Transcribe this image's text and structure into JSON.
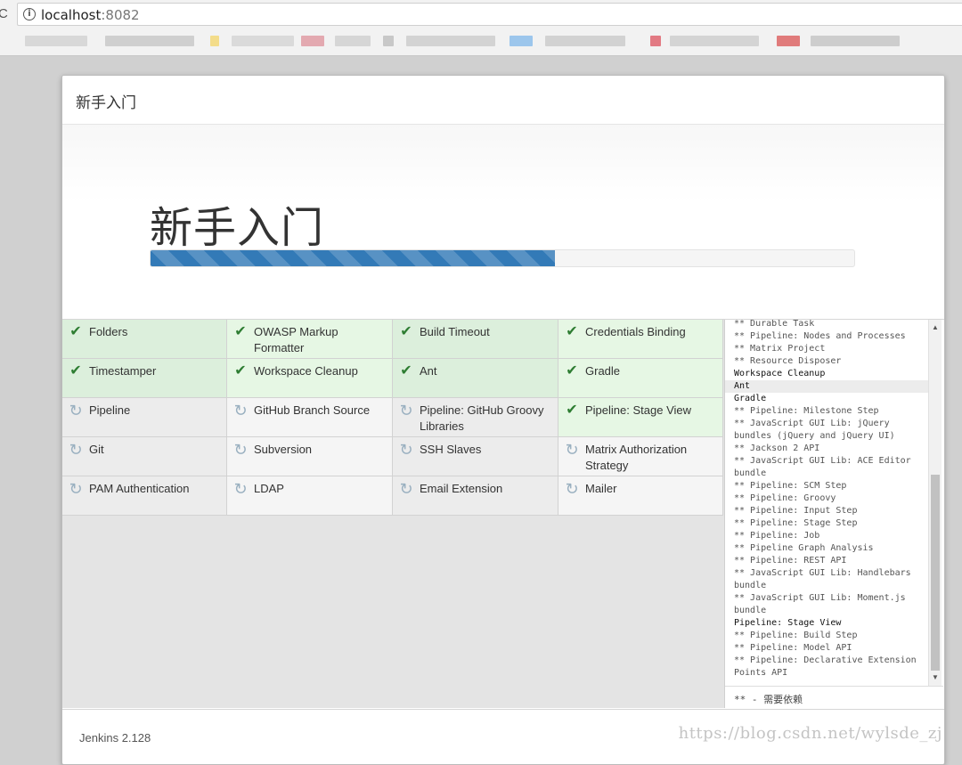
{
  "browser": {
    "url_host": "localhost",
    "url_port": ":8082"
  },
  "dialog": {
    "header_title": "新手入门",
    "hero_title": "新手入门",
    "progress_fraction": 0.575
  },
  "plugins": [
    {
      "name": "Folders",
      "status": "done"
    },
    {
      "name": "OWASP Markup Formatter",
      "status": "done"
    },
    {
      "name": "Build Timeout",
      "status": "done"
    },
    {
      "name": "Credentials Binding",
      "status": "done"
    },
    {
      "name": "Timestamper",
      "status": "done"
    },
    {
      "name": "Workspace Cleanup",
      "status": "done"
    },
    {
      "name": "Ant",
      "status": "done"
    },
    {
      "name": "Gradle",
      "status": "done"
    },
    {
      "name": "Pipeline",
      "status": "pending"
    },
    {
      "name": "GitHub Branch Source",
      "status": "pending"
    },
    {
      "name": "Pipeline: GitHub Groovy Libraries",
      "status": "pending"
    },
    {
      "name": "Pipeline: Stage View",
      "status": "done"
    },
    {
      "name": "Git",
      "status": "pending"
    },
    {
      "name": "Subversion",
      "status": "pending"
    },
    {
      "name": "SSH Slaves",
      "status": "pending"
    },
    {
      "name": "Matrix Authorization Strategy",
      "status": "pending"
    },
    {
      "name": "PAM Authentication",
      "status": "pending"
    },
    {
      "name": "LDAP",
      "status": "pending"
    },
    {
      "name": "Email Extension",
      "status": "pending"
    },
    {
      "name": "Mailer",
      "status": "pending"
    }
  ],
  "log": {
    "lines": [
      {
        "text": "** Durable Task",
        "kind": "dep"
      },
      {
        "text": "** Pipeline: Nodes and Processes",
        "kind": "dep"
      },
      {
        "text": "** Matrix Project",
        "kind": "dep"
      },
      {
        "text": "** Resource Disposer",
        "kind": "dep"
      },
      {
        "text": "Workspace Cleanup",
        "kind": "head"
      },
      {
        "text": "Ant",
        "kind": "head-hl"
      },
      {
        "text": "Gradle",
        "kind": "head"
      },
      {
        "text": "** Pipeline: Milestone Step",
        "kind": "dep"
      },
      {
        "text": "** JavaScript GUI Lib: jQuery bundles (jQuery and jQuery UI)",
        "kind": "dep"
      },
      {
        "text": "** Jackson 2 API",
        "kind": "dep"
      },
      {
        "text": "** JavaScript GUI Lib: ACE Editor bundle",
        "kind": "dep"
      },
      {
        "text": "** Pipeline: SCM Step",
        "kind": "dep"
      },
      {
        "text": "** Pipeline: Groovy",
        "kind": "dep"
      },
      {
        "text": "** Pipeline: Input Step",
        "kind": "dep"
      },
      {
        "text": "** Pipeline: Stage Step",
        "kind": "dep"
      },
      {
        "text": "** Pipeline: Job",
        "kind": "dep"
      },
      {
        "text": "** Pipeline Graph Analysis",
        "kind": "dep"
      },
      {
        "text": "** Pipeline: REST API",
        "kind": "dep"
      },
      {
        "text": "** JavaScript GUI Lib: Handlebars bundle",
        "kind": "dep"
      },
      {
        "text": "** JavaScript GUI Lib: Moment.js bundle",
        "kind": "dep"
      },
      {
        "text": "Pipeline: Stage View",
        "kind": "head"
      },
      {
        "text": "** Pipeline: Build Step",
        "kind": "dep"
      },
      {
        "text": "** Pipeline: Model API",
        "kind": "dep"
      },
      {
        "text": "** Pipeline: Declarative Extension Points API",
        "kind": "dep"
      }
    ],
    "footer": "** - 需要依赖"
  },
  "footer": {
    "version": "Jenkins 2.128",
    "watermark": "https://blog.csdn.net/wylsde_zj"
  },
  "icons": {
    "done": "check-icon",
    "pending": "refresh-icon"
  }
}
